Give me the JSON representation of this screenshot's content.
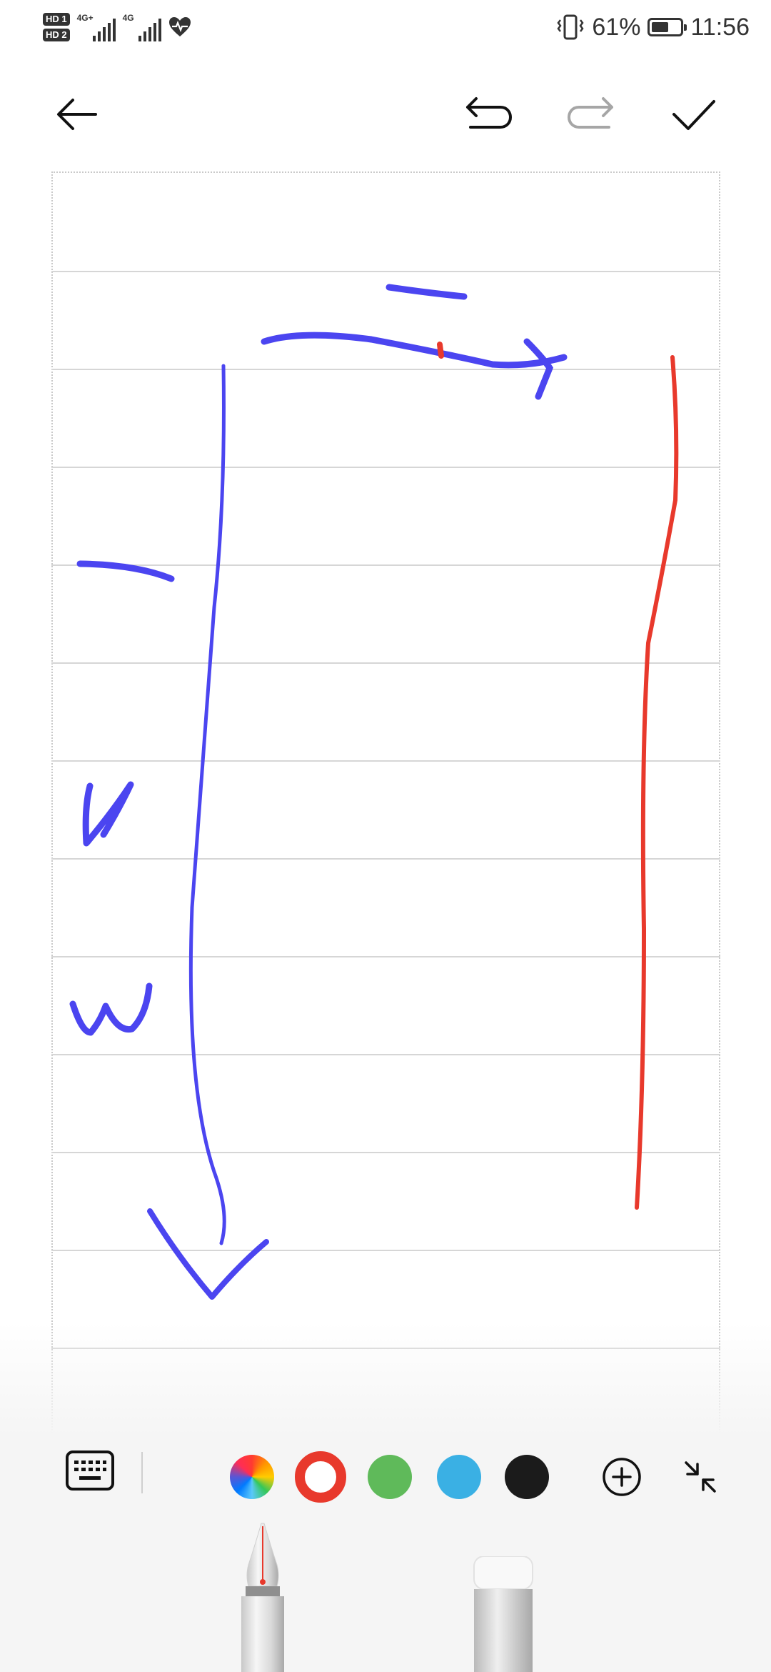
{
  "status_bar": {
    "sim1": "HD 1",
    "sim2": "HD 2",
    "net1": "4G+",
    "net2": "4G",
    "battery_percent": "61%",
    "battery_level": 0.61,
    "time": "11:56",
    "icons": [
      "signal-icon",
      "heart-health-icon",
      "vibrate-icon",
      "battery-icon"
    ]
  },
  "toolbar": {
    "icons": [
      "back-arrow-icon",
      "undo-icon",
      "redo-icon",
      "check-icon"
    ]
  },
  "palette": {
    "icons": [
      "keyboard-icon",
      "color-wheel-icon",
      "add-color-icon",
      "collapse-icon"
    ],
    "colors": {
      "red": "#e8392c",
      "green": "#5fba5a",
      "blue": "#3ab0e4",
      "black": "#1b1b1b",
      "ink_blue": "#4b45f0"
    },
    "selected_color": "red"
  },
  "tools": {
    "items": [
      "fountain-pen-tool",
      "eraser-tool"
    ],
    "selected": "fountain-pen-tool"
  }
}
